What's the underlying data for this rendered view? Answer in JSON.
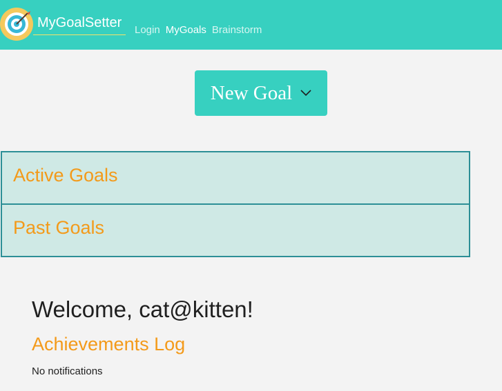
{
  "navbar": {
    "brand": "MyGoalSetter",
    "links": [
      {
        "label": "Login"
      },
      {
        "label": "MyGoals",
        "active": true
      },
      {
        "label": "Brainstorm"
      }
    ],
    "background": "#37d0c0",
    "logo_icon": "target-dart-icon"
  },
  "new_goal": {
    "label": "New Goal",
    "icon": "chevron-down-icon"
  },
  "panels": [
    {
      "title": "Active Goals"
    },
    {
      "title": "Past Goals"
    }
  ],
  "welcome": "Welcome, cat@kitten!",
  "achievements": {
    "title": "Achievements Log",
    "message": "No notifications"
  },
  "colors": {
    "accent": "#37d0c0",
    "heading_orange": "#f39a1a",
    "panel_bg": "#cfe9e5",
    "panel_border": "#2c8f96"
  }
}
